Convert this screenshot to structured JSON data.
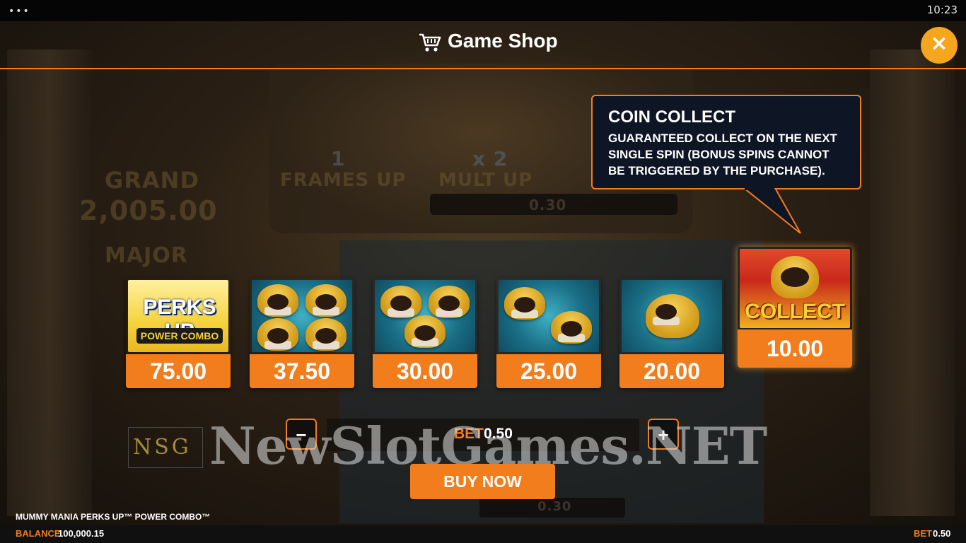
{
  "system": {
    "menu_dots": "•••",
    "time": "10:23"
  },
  "background": {
    "grand_label": "GRAND",
    "grand_value": "2,005.00",
    "major_label": "MAJOR",
    "frames_up_count": "1",
    "frames_up_label": "FRAMES UP",
    "mult_up_value": "x 2",
    "mult_up_label": "MULT UP",
    "top_bar_value": "0.30",
    "bottom_bar_value": "0.30"
  },
  "shop": {
    "title": "Game Shop",
    "close_symbol": "×",
    "tooltip": {
      "title": "COIN COLLECT",
      "description": "GUARANTEED COLLECT ON THE NEXT SINGLE SPIN (BONUS SPINS CANNOT BE TRIGGERED BY THE PURCHASE)."
    },
    "items": [
      {
        "name": "perks-up-power-combo",
        "logo": "PERKS UP",
        "sub": "POWER COMBO",
        "price": "75.00"
      },
      {
        "name": "four-mummies",
        "price": "37.50"
      },
      {
        "name": "three-mummies",
        "price": "30.00"
      },
      {
        "name": "two-mummies",
        "price": "25.00"
      },
      {
        "name": "one-mummy",
        "price": "20.00"
      },
      {
        "name": "coin-collect",
        "label": "COLLECT",
        "price": "10.00",
        "selected": true
      }
    ],
    "bet": {
      "label": "BET",
      "value": "0.50",
      "minus": "−",
      "plus": "+"
    },
    "buy_label": "BUY NOW"
  },
  "watermark": {
    "logo": "NSG",
    "text": "NewSlotGames.NET"
  },
  "footer": {
    "game_name": "MUMMY MANIA PERKS UP™ POWER COMBO™",
    "balance_label": "BALANCE",
    "balance_value": "100,000.15",
    "bet_label": "BET",
    "bet_value": "0.50"
  },
  "colors": {
    "accent": "#f27d1c",
    "close": "#f5a61c",
    "tooltip_bg": "#0e1626"
  }
}
